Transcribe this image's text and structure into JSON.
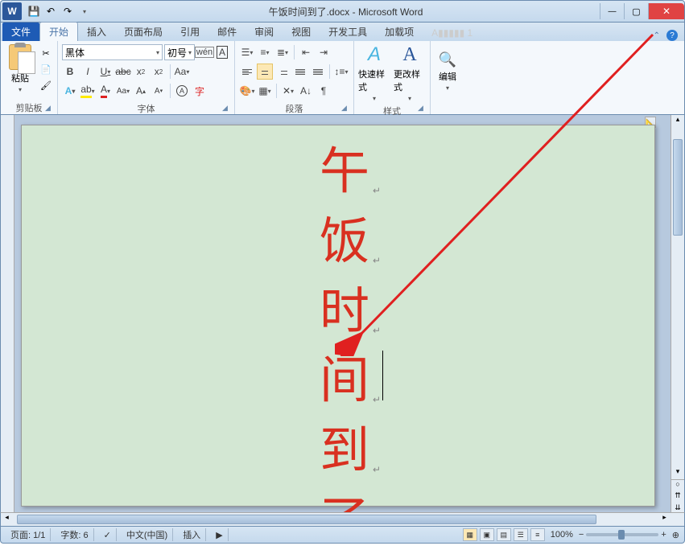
{
  "title": "午饭时间到了.docx - Microsoft Word",
  "app_letter": "W",
  "tabs": {
    "file": "文件",
    "home": "开始",
    "insert": "插入",
    "layout": "页面布局",
    "references": "引用",
    "mailings": "邮件",
    "review": "审阅",
    "view": "视图",
    "developer": "开发工具",
    "addins": "加载项"
  },
  "clipboard": {
    "paste": "粘贴",
    "label": "剪贴板"
  },
  "font": {
    "name": "黑体",
    "size": "初号",
    "label": "字体"
  },
  "paragraph": {
    "label": "段落"
  },
  "styles": {
    "quick": "快速样式",
    "change": "更改样式",
    "label": "样式"
  },
  "editing": {
    "edit": "编辑"
  },
  "document": {
    "chars": [
      "午",
      "饭",
      "时",
      "间",
      "到",
      "了"
    ]
  },
  "status": {
    "page": "页面: 1/1",
    "words": "字数: 6",
    "language": "中文(中国)",
    "insert": "插入",
    "zoom": "100%"
  }
}
